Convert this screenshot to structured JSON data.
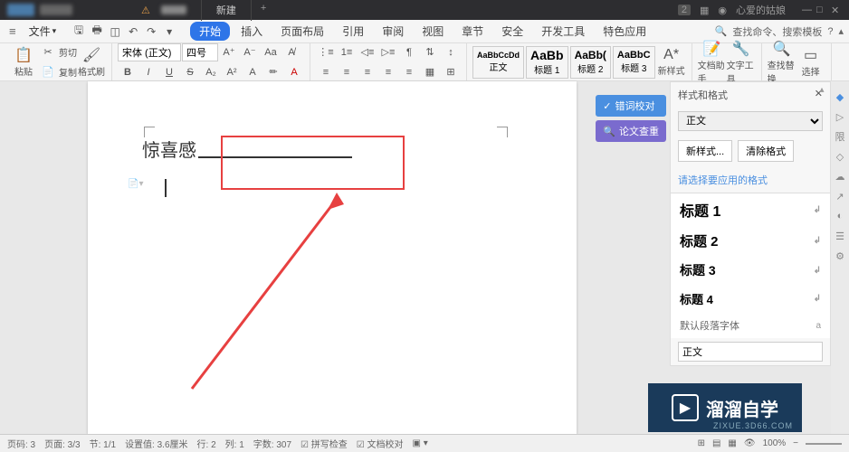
{
  "titleBar": {
    "tab1Warning": "⚠",
    "tab2": "新建",
    "userText": "心爱的姑娘",
    "badge": "2"
  },
  "menuBar": {
    "file": "文件",
    "tabs": [
      "开始",
      "插入",
      "页面布局",
      "引用",
      "审阅",
      "视图",
      "章节",
      "安全",
      "开发工具",
      "特色应用"
    ],
    "search": "查找命令、搜索模板"
  },
  "toolbar": {
    "paste": "粘贴",
    "copy": "复制",
    "cut": "剪切",
    "formatBrush": "格式刷",
    "font": "宋体 (正文)",
    "size": "四号",
    "styles": {
      "s1": {
        "preview": "AaBbCcDd",
        "name": "正文"
      },
      "s2": {
        "preview": "AaBb",
        "name": "标题 1"
      },
      "s3": {
        "preview": "AaBb(",
        "name": "标题 2"
      },
      "s4": {
        "preview": "AaBbC",
        "name": "标题 3"
      }
    },
    "newStyle": "新样式",
    "docAssist": "文档助手",
    "textTools": "文字工具",
    "findReplace": "查找替换",
    "select": "选择"
  },
  "document": {
    "text": "惊喜感"
  },
  "sideButtons": {
    "spell": "错词校对",
    "paper": "论文查重"
  },
  "stylesPanel": {
    "title": "样式和格式",
    "bodyText": "正文",
    "newStyle": "新样式...",
    "clearFormat": "清除格式",
    "selectLabel": "请选择要应用的格式",
    "items": [
      "标题 1",
      "标题 2",
      "标题 3",
      "标题 4",
      "默认段落字体",
      "正文"
    ]
  },
  "statusBar": {
    "pageCount": "页码: 3",
    "pages": "页面: 3/3",
    "section": "节: 1/1",
    "setValue": "设置值: 3.6厘米",
    "line": "行: 2",
    "col": "列: 1",
    "wordCount": "字数: 307",
    "spellCheck": "拼写检查",
    "docCheck": "文档校对",
    "zoom": "100%"
  },
  "watermark": {
    "text": "溜溜自学",
    "url": "ZIXUE.3D66.COM"
  }
}
